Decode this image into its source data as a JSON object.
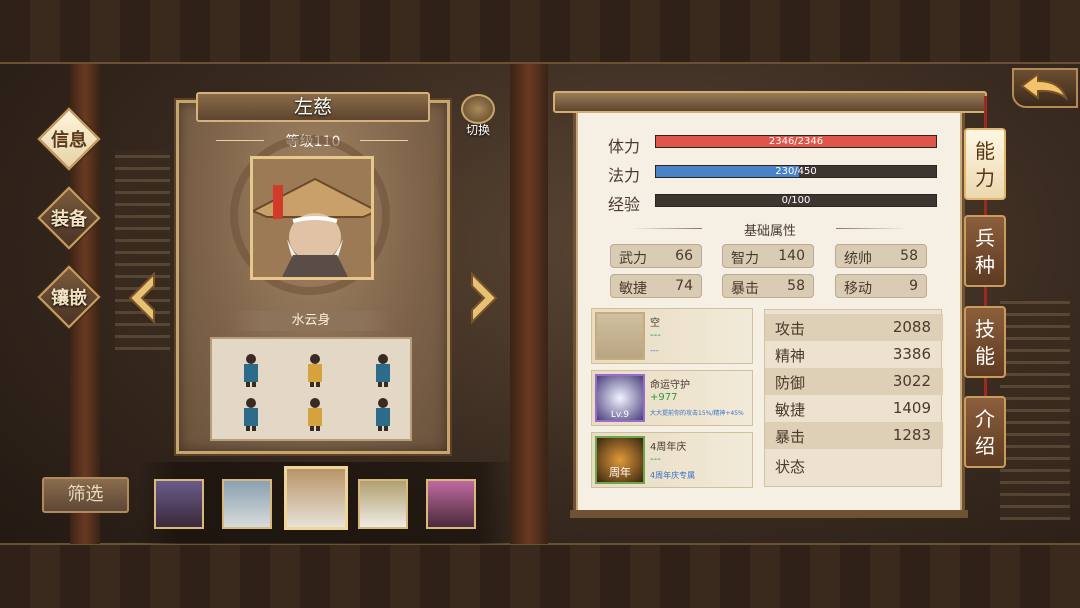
{
  "nav": {
    "items": [
      {
        "label": "信息",
        "active": true
      },
      {
        "label": "装备",
        "active": false
      },
      {
        "label": "镶嵌",
        "active": false
      }
    ]
  },
  "hero": {
    "name": "左慈",
    "level": "等级110",
    "form": "水云身",
    "switch_label": "切换"
  },
  "filter_label": "筛选",
  "stats_bars": {
    "hp": {
      "label": "体力",
      "value": "2346/2346",
      "fraction": 1.0,
      "color": "#e0554a"
    },
    "mp": {
      "label": "法力",
      "value": "230/450",
      "fraction": 0.511,
      "color": "#4a82c8"
    },
    "exp": {
      "label": "经验",
      "value": "0/100",
      "fraction": 0.0,
      "color": "#d9a441"
    }
  },
  "base_title": "基础属性",
  "attributes": [
    {
      "name": "武力",
      "value": "66"
    },
    {
      "name": "智力",
      "value": "140"
    },
    {
      "name": "统帅",
      "value": "58"
    },
    {
      "name": "敏捷",
      "value": "74"
    },
    {
      "name": "暴击",
      "value": "58"
    },
    {
      "name": "移动",
      "value": "9"
    }
  ],
  "equips": [
    {
      "title": "空",
      "line2": "---",
      "line3": "---"
    },
    {
      "title": "命运守护",
      "line2": "+977",
      "line3": "大大提前你的攻击15%/精神+45%",
      "badge": "Lv.9"
    },
    {
      "title": "4周年庆",
      "line2": "---",
      "line3": "4周年庆专属",
      "badge": "周年"
    }
  ],
  "combat_stats": [
    {
      "name": "攻击",
      "value": "2088"
    },
    {
      "name": "精神",
      "value": "3386"
    },
    {
      "name": "防御",
      "value": "3022"
    },
    {
      "name": "敏捷",
      "value": "1409"
    },
    {
      "name": "暴击",
      "value": "1283"
    },
    {
      "name": "状态",
      "value": ""
    }
  ],
  "right_tabs": [
    {
      "label": "能力",
      "active": true
    },
    {
      "label": "兵种",
      "active": false
    },
    {
      "label": "技能",
      "active": false
    },
    {
      "label": "介绍",
      "active": false
    }
  ],
  "colors": {
    "accent": "#c9a56e",
    "panel": "#f6f0e4",
    "hp": "#e0554a",
    "mp": "#4a82c8"
  }
}
